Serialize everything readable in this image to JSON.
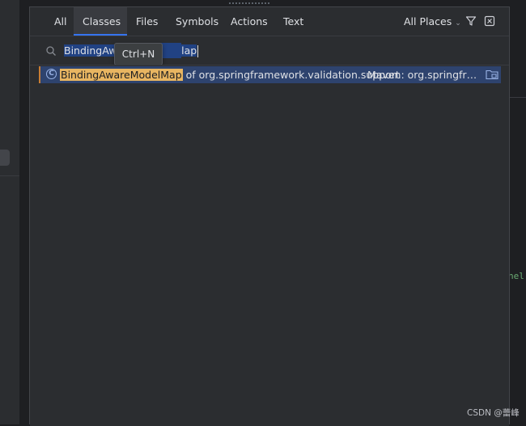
{
  "tabs": [
    {
      "label": "All"
    },
    {
      "label": "Classes"
    },
    {
      "label": "Files"
    },
    {
      "label": "Symbols"
    },
    {
      "label": "Actions"
    },
    {
      "label": "Text"
    }
  ],
  "selected_tab": "Classes",
  "places": {
    "label": "All Places",
    "icon": "chevron-down-icon"
  },
  "toolbar_icons": [
    "filter-icon",
    "pin-window-icon"
  ],
  "search": {
    "value_visible_start": "BindingAwa",
    "value_visible_end": "lap",
    "icon": "search-icon"
  },
  "tooltip": {
    "text": "Ctrl+N"
  },
  "results": [
    {
      "icon": "class-icon",
      "icon_letter": "C",
      "name": "BindingAwareModelMap",
      "package": "of org.springframework.validation.support",
      "location": "Maven: org.springframe…",
      "location_icon": "library-folder-icon"
    }
  ],
  "background": {
    "right_edge_fragment": "nel"
  },
  "watermark": "CSDN @蕾峰",
  "colors": {
    "accent": "#3574f0",
    "selection": "#2e436e",
    "match_highlight": "#e8b561",
    "popup_bg": "#2b2d30"
  }
}
